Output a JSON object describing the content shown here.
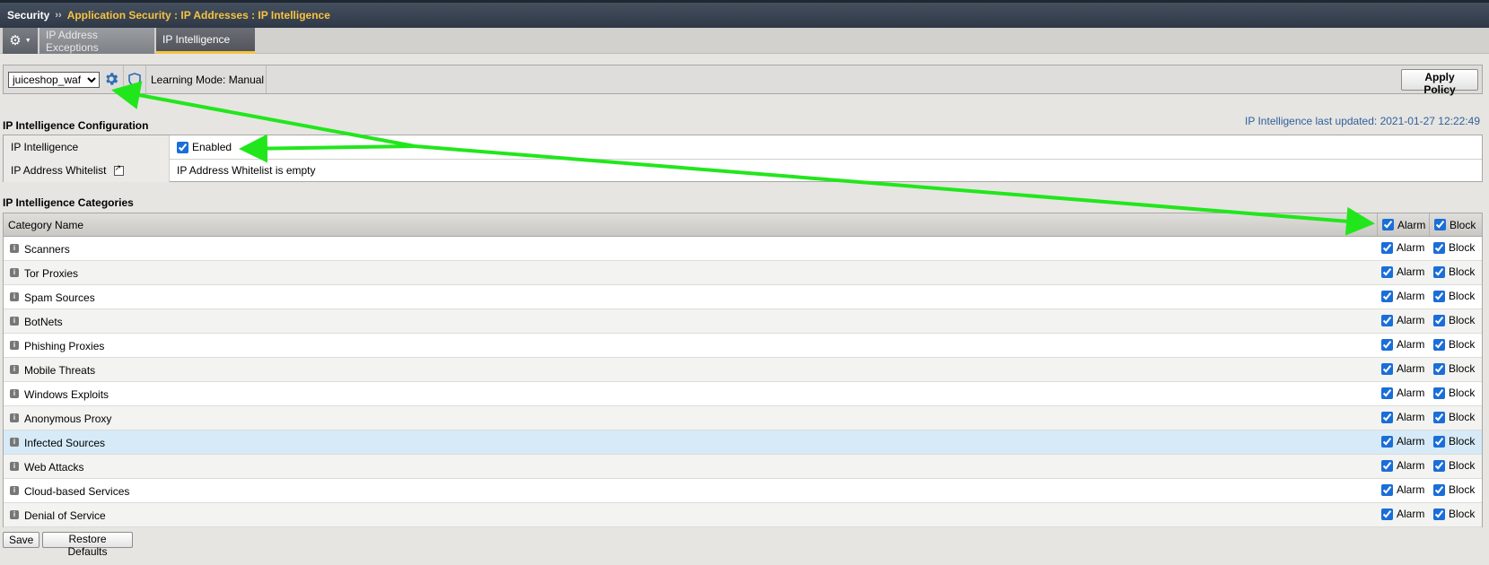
{
  "breadcrumb": {
    "root": "Security",
    "separator": "››",
    "path": "Application Security : IP Addresses : IP Intelligence"
  },
  "tabs": [
    {
      "label": "IP Address Exceptions",
      "active": false
    },
    {
      "label": "IP Intelligence",
      "active": true
    }
  ],
  "policy": {
    "selected": "juiceshop_waf",
    "learning_mode": "Learning Mode: Manual",
    "apply_label": "Apply Policy"
  },
  "config": {
    "title": "IP Intelligence Configuration",
    "last_updated": "IP Intelligence last updated: 2021-01-27 12:22:49",
    "rows": [
      {
        "label": "IP Intelligence",
        "value": "Enabled",
        "checked": true
      },
      {
        "label": "IP Address Whitelist",
        "value": "IP Address Whitelist is empty"
      }
    ]
  },
  "categories": {
    "title": "IP Intelligence Categories",
    "header": {
      "name": "Category Name",
      "alarm": "Alarm",
      "block": "Block"
    },
    "rows": [
      {
        "name": "Scanners",
        "alarm": true,
        "block": true
      },
      {
        "name": "Tor Proxies",
        "alarm": true,
        "block": true
      },
      {
        "name": "Spam Sources",
        "alarm": true,
        "block": true
      },
      {
        "name": "BotNets",
        "alarm": true,
        "block": true
      },
      {
        "name": "Phishing Proxies",
        "alarm": true,
        "block": true
      },
      {
        "name": "Mobile Threats",
        "alarm": true,
        "block": true
      },
      {
        "name": "Windows Exploits",
        "alarm": true,
        "block": true
      },
      {
        "name": "Anonymous Proxy",
        "alarm": true,
        "block": true
      },
      {
        "name": "Infected Sources",
        "alarm": true,
        "block": true
      },
      {
        "name": "Web Attacks",
        "alarm": true,
        "block": true
      },
      {
        "name": "Cloud-based Services",
        "alarm": true,
        "block": true
      },
      {
        "name": "Denial of Service",
        "alarm": true,
        "block": true
      }
    ]
  },
  "buttons": {
    "save": "Save",
    "restore": "Restore Defaults"
  },
  "colors": {
    "accent": "#f6c343",
    "annotation": "#22e61c",
    "link": "#2f5f9e",
    "highlight_row": "#d6eaf8"
  }
}
